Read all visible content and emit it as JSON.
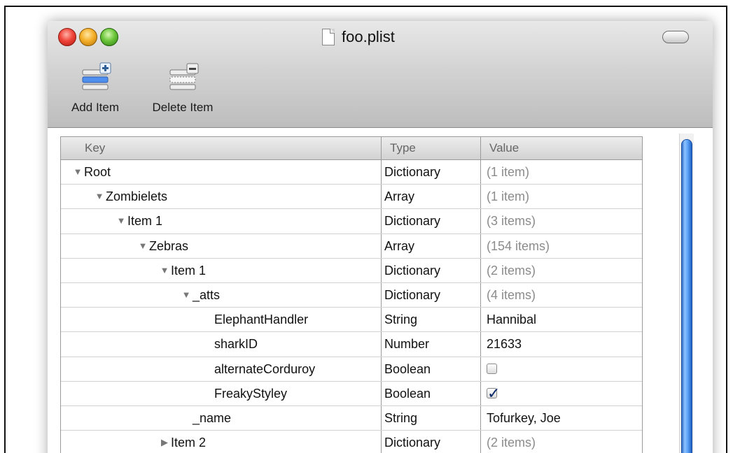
{
  "window": {
    "title": "foo.plist",
    "controls": {
      "close": "close",
      "minimize": "minimize",
      "zoom": "zoom"
    }
  },
  "toolbar": {
    "add_item_label": "Add Item",
    "delete_item_label": "Delete Item",
    "add_icon": "add-row-icon",
    "delete_icon": "delete-row-icon"
  },
  "table": {
    "columns": {
      "key": "Key",
      "type": "Type",
      "value": "Value"
    },
    "rows": [
      {
        "key": "Root",
        "type": "Dictionary",
        "value": "(1 item)",
        "depth": 0,
        "disclosure": "expanded",
        "value_style": "gray"
      },
      {
        "key": "Zombielets",
        "type": "Array",
        "value": "(1 item)",
        "depth": 1,
        "disclosure": "expanded",
        "value_style": "gray"
      },
      {
        "key": "Item 1",
        "type": "Dictionary",
        "value": "(3 items)",
        "depth": 2,
        "disclosure": "expanded",
        "value_style": "gray"
      },
      {
        "key": "Zebras",
        "type": "Array",
        "value": "(154 items)",
        "depth": 3,
        "disclosure": "expanded",
        "value_style": "gray"
      },
      {
        "key": "Item 1",
        "type": "Dictionary",
        "value": "(2 items)",
        "depth": 4,
        "disclosure": "expanded",
        "value_style": "gray"
      },
      {
        "key": "_atts",
        "type": "Dictionary",
        "value": "(4 items)",
        "depth": 5,
        "disclosure": "expanded",
        "value_style": "gray"
      },
      {
        "key": "ElephantHandler",
        "type": "String",
        "value": "Hannibal",
        "depth": 6,
        "disclosure": "none",
        "value_style": "normal"
      },
      {
        "key": "sharkID",
        "type": "Number",
        "value": "21633",
        "depth": 6,
        "disclosure": "none",
        "value_style": "normal"
      },
      {
        "key": "alternateCorduroy",
        "type": "Boolean",
        "value": "",
        "checked": false,
        "depth": 6,
        "disclosure": "none",
        "value_style": "checkbox"
      },
      {
        "key": "FreakyStyley",
        "type": "Boolean",
        "value": "",
        "checked": true,
        "depth": 6,
        "disclosure": "none",
        "value_style": "checkbox"
      },
      {
        "key": "_name",
        "type": "String",
        "value": "Tofurkey, Joe",
        "depth": 5,
        "disclosure": "none",
        "value_style": "normal"
      },
      {
        "key": "Item 2",
        "type": "Dictionary",
        "value": "(2 items)",
        "depth": 4,
        "disclosure": "collapsed",
        "value_style": "gray"
      }
    ]
  },
  "colors": {
    "scrollbar_thumb": "#5aa2f7",
    "close_button": "#f0453a",
    "minimize_button": "#f5b02a",
    "zoom_button": "#6cc63a"
  }
}
